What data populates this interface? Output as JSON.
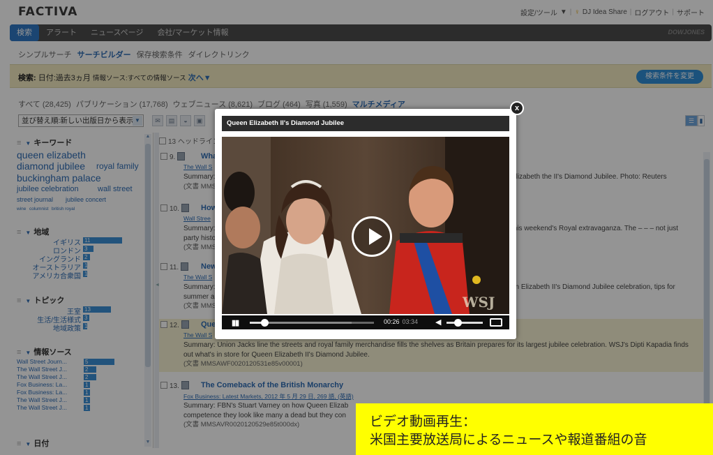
{
  "app": {
    "logo": "FACTIVA",
    "top_links": [
      "設定/ツール",
      "DJ Idea Share",
      "ログアウト",
      "サポート"
    ],
    "top_links_caret": "▼"
  },
  "nav": {
    "tabs": [
      "検索",
      "アラート",
      "ニュースページ",
      "会社/マーケット情報"
    ],
    "active_tab": "検索",
    "brand": "DOWJONES"
  },
  "subnav": {
    "items": [
      "シンプルサーチ",
      "サーチビルダー",
      "保存検索条件",
      "ダイレクトリンク"
    ],
    "selected": "サーチビルダー"
  },
  "search_summary": {
    "label": "検索:",
    "date": "日付:過去3ヵ月",
    "source": "情報ソース:すべての情報ソース",
    "next": "次へ▼",
    "modify_button": "検索条件を変更"
  },
  "filters": {
    "items": [
      "すべて (28,425)",
      "パブリケーション (17,768)",
      "ウェブニュース (8,621)",
      "ブログ (464)",
      "写真 (1,559)",
      "マルチメディア"
    ],
    "selected": "マルチメディア"
  },
  "sort": {
    "label": "並び替え順:新しい出版日から表示",
    "caret": "▼",
    "toolbar_icons": [
      "email-icon",
      "print-icon",
      "save-icon",
      "format-icon"
    ]
  },
  "left_panel": {
    "keywords": {
      "title": "キーワード",
      "terms": [
        {
          "text": "queen elizabeth",
          "size": "big"
        },
        {
          "text": "diamond jubilee",
          "size": "big"
        },
        {
          "text": "royal family",
          "size": "mid"
        },
        {
          "text": "buckingham palace",
          "size": "big"
        },
        {
          "text": "jubilee celebration",
          "size": "mid"
        },
        {
          "text": "wall street",
          "size": "mid"
        },
        {
          "text": "street journal",
          "size": "small"
        },
        {
          "text": "jubilee concert",
          "size": "small"
        },
        {
          "text": "wine",
          "size": "tiny"
        },
        {
          "text": "columnist",
          "size": "tiny"
        },
        {
          "text": "british royal",
          "size": "tiny"
        }
      ]
    },
    "region": {
      "title": "地域",
      "items": [
        {
          "label": "イギリス",
          "count": "11",
          "fraction": 1.0
        },
        {
          "label": "ロンドン",
          "count": "3",
          "fraction": 0.27
        },
        {
          "label": "イングランド",
          "count": "2",
          "fraction": 0.18
        },
        {
          "label": "オーストラリア",
          "count": "1",
          "fraction": 0.09
        },
        {
          "label": "アメリカ合衆国",
          "count": "1",
          "fraction": 0.09
        }
      ]
    },
    "topic": {
      "title": "トピック",
      "items": [
        {
          "label": "王室",
          "count": "13",
          "fraction": 1.0
        },
        {
          "label": "生活/生活様式",
          "count": "3",
          "fraction": 0.23
        },
        {
          "label": "地域政策",
          "count": "1",
          "fraction": 0.08
        }
      ]
    },
    "sources": {
      "title": "情報ソース",
      "items": [
        {
          "label": "Wall Street Journ...",
          "count": "5",
          "fraction": 1.0
        },
        {
          "label": "The Wall Street J...",
          "count": "2",
          "fraction": 0.4
        },
        {
          "label": "The Wall Street J...",
          "count": "2",
          "fraction": 0.4
        },
        {
          "label": "Fox Business: La...",
          "count": "1",
          "fraction": 0.2
        },
        {
          "label": "Fox Business: La...",
          "count": "1",
          "fraction": 0.2
        },
        {
          "label": "The Wall Street J...",
          "count": "1",
          "fraction": 0.2
        },
        {
          "label": "The Wall Street J...",
          "count": "1",
          "fraction": 0.2
        }
      ]
    },
    "date": {
      "title": "日付"
    }
  },
  "results": {
    "header": "13 ヘッドライン",
    "items": [
      {
        "num": "9.",
        "title": "What",
        "source": "The Wall S",
        "summary": "Summary:",
        "summary_tail": "Elizabeth the II's Diamond Jubilee. Photo: Reuters",
        "doc": "(文書 MMS"
      },
      {
        "num": "10.",
        "title": "How t",
        "source": "Wall Stree",
        "summary": "Summary:",
        "summary_tail": "this weekend's Royal extravaganza. The – – – not just",
        "extra": "party histo",
        "doc": "(文書 MMS"
      },
      {
        "num": "11.",
        "title": "New C",
        "source": "The Wall S",
        "summary": "Summary:",
        "summary_tail": "en Elizabeth II's Diamond Jubilee celebration, tips for",
        "extra": "summer a",
        "doc": "(文書 MMS"
      },
      {
        "num": "12.",
        "title": "Quee",
        "source": "The Wall S",
        "summary": "Summary: Union Jacks line the streets and royal family merchandise fills the shelves as Britain prepares for its largest jubilee celebration. WSJ's Dipti Kapadia finds out what's in store for Queen Elizabeth II's Diamond Jubilee.",
        "doc": "(文書 MMSAWF0020120531e85v00001)"
      },
      {
        "num": "13.",
        "title": "The Comeback of the British Monarchy",
        "source": "Fox Business: Latest Markets, 2012 年 5 月 29 日, 269 語, (英語)",
        "summary": "Summary: FBN's Stuart Varney on how Queen Elizab",
        "extra": "competence they look like many a dead but they con",
        "doc": "(文書 MMSAVR0020120529e85t000dx)"
      }
    ]
  },
  "video_modal": {
    "title": "Queen Elizabeth II's Diamond Jubilee",
    "close": "x",
    "time_current": "00:26",
    "time_total": "03:34",
    "progress": 0.12,
    "buffered": 0.82,
    "volume": 0.3,
    "watermark": "WSJ"
  },
  "caption": {
    "line1": "ビデオ動画再生：",
    "line2": "米国主要放送局によるニュースや報道番組の音"
  },
  "colors": {
    "accent": "#2f78c4",
    "link": "#2f6db5",
    "highlight_bg": "#f6f1d2",
    "caption_bg": "#ffff00",
    "nav_bg": "#4d4d4d"
  }
}
